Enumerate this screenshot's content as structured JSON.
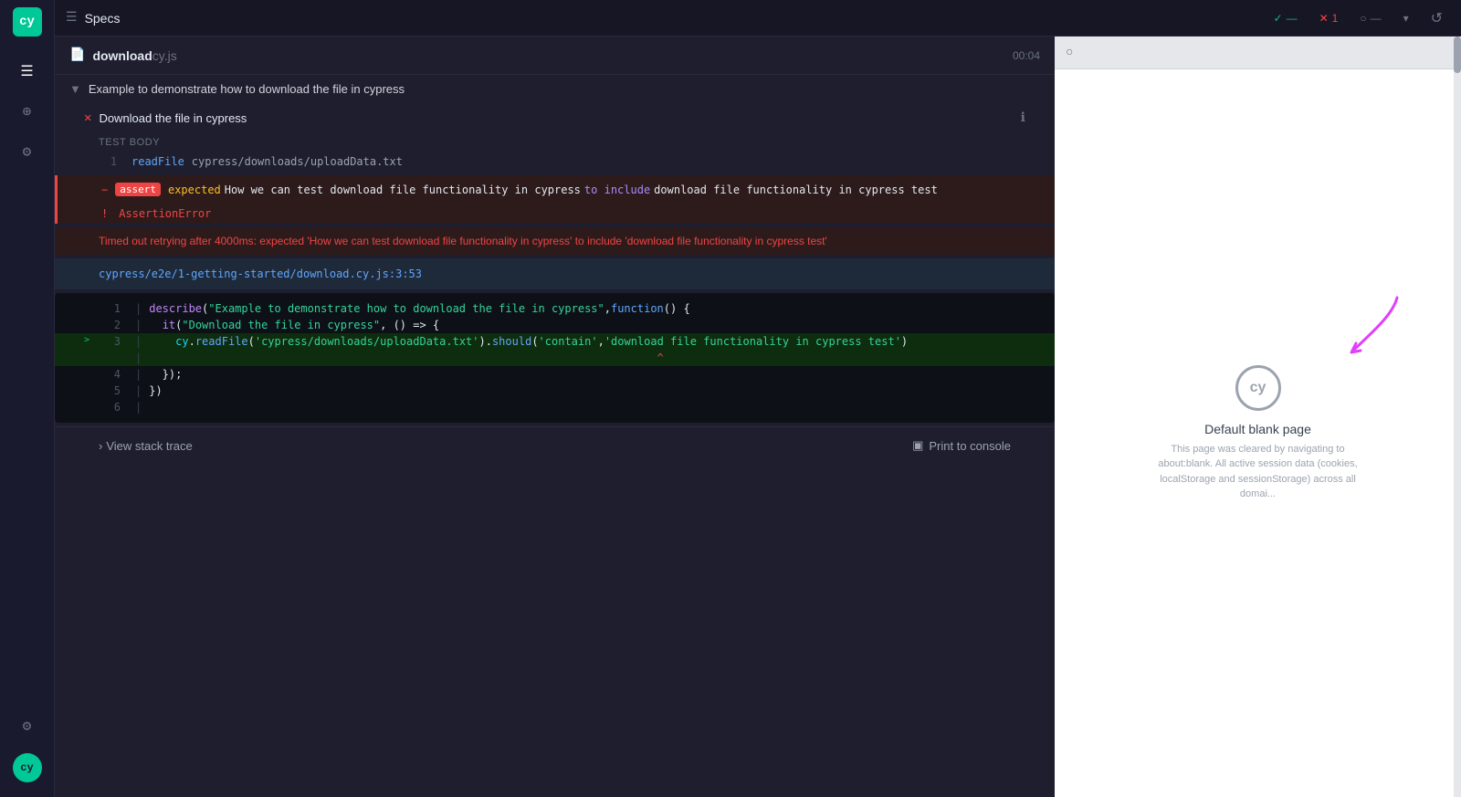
{
  "sidebar": {
    "logo_text": "cy",
    "items": [
      {
        "name": "specs",
        "icon": "≡",
        "active": true
      },
      {
        "name": "selector-playground",
        "icon": "⊕"
      },
      {
        "name": "settings",
        "icon": "⚙"
      },
      {
        "name": "settings2",
        "icon": "⚙"
      }
    ],
    "bottom": {
      "keyboard_icon": "⌨",
      "avatar_text": "cy"
    }
  },
  "topbar": {
    "specs_icon": "☰",
    "title": "Specs",
    "pass_icon": "✓",
    "pass_count": "",
    "fail_icon": "✕",
    "fail_count": "1",
    "pending_icon": "○",
    "pending_count": "",
    "dropdown_icon": "▾",
    "reload_icon": "↺"
  },
  "file_header": {
    "icon": "📄",
    "name": "download",
    "ext": " cy.js",
    "time": "00:04"
  },
  "suite": {
    "label": "Example to demonstrate how to download the file in cypress"
  },
  "test": {
    "fail_icon": "✕",
    "label": "Download the file in cypress",
    "info_icon": "ℹ"
  },
  "test_body_label": "TEST BODY",
  "steps": [
    {
      "num": "1",
      "cmd": "readFile",
      "arg": "cypress/downloads/uploadData.txt"
    }
  ],
  "error": {
    "dash": "-",
    "assert_badge": "assert",
    "expected_label": "expected",
    "text1": "How we can test download file functionality in cypress",
    "to_include": "to include",
    "text2": "download file functionality in cypress test"
  },
  "assertion_error": {
    "excl": "!",
    "label": "AssertionError"
  },
  "timeout_message": "Timed out retrying after 4000ms: expected 'How we can test download file functionality in cypress' to include 'download file functionality in cypress test'",
  "file_link": "cypress/e2e/1-getting-started/download.cy.js:3:53",
  "code_lines": [
    {
      "num": "1",
      "pipe": "|",
      "content": "describe(\"Example to demonstrate how to download the file in cypress\", function () {"
    },
    {
      "num": "2",
      "pipe": "|",
      "content": "  it(\"Download the file in cypress\", () => {"
    },
    {
      "num": "3",
      "pipe": "|",
      "content": "    cy.readFile('cypress/downloads/uploadData.txt').should('contain', 'download file functionality in cypress test')",
      "active": true
    },
    {
      "num": "",
      "pipe": "|",
      "content": "                                                         ^"
    },
    {
      "num": "4",
      "pipe": "|",
      "content": "  });"
    },
    {
      "num": "5",
      "pipe": "|",
      "content": "})"
    },
    {
      "num": "6",
      "pipe": "|",
      "content": ""
    }
  ],
  "bottom_actions": {
    "stack_trace_arrow": "›",
    "stack_trace_label": "View stack trace",
    "print_icon": "▣",
    "print_label": "Print to console"
  },
  "preview": {
    "icon": "○",
    "cy_logo": "cy",
    "blank_title": "Default blank page",
    "blank_desc": "This page was cleared by navigating to about:blank. All active session data (cookies, localStorage and sessionStorage) across all domai..."
  }
}
